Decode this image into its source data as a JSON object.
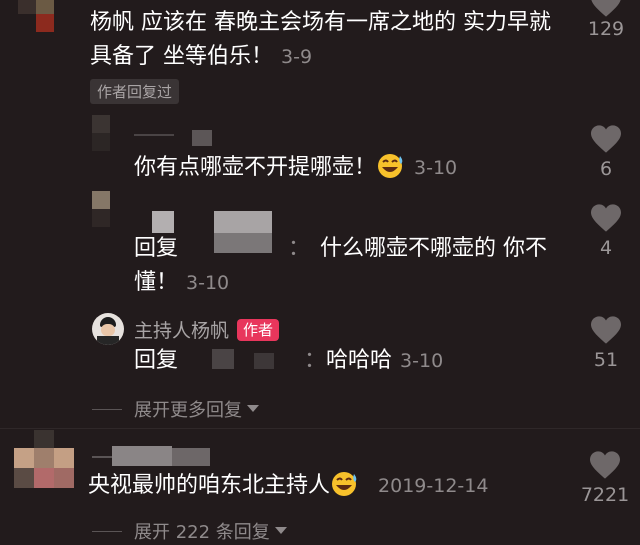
{
  "comments": [
    {
      "text": "杨帆 应该在 春晚主会场有一席之地的 实力早就具备了 坐等伯乐！",
      "date": "3-9",
      "likes": "129",
      "author_replied": "作者回复过",
      "replies": [
        {
          "prefix": "",
          "text": "你有点哪壶不开提哪壶！",
          "emoji": "grin-sweat-emoji",
          "date": "3-10",
          "likes": "6"
        },
        {
          "prefix": "回复",
          "separator": "：",
          "text": "什么哪壶不哪壶的 你不懂！",
          "date": "3-10",
          "likes": "4"
        },
        {
          "username": "主持人杨帆",
          "badge": "作者",
          "prefix": "回复",
          "separator": "：",
          "text": "哈哈哈",
          "date": "3-10",
          "likes": "51"
        }
      ],
      "expand_label": "展开更多回复"
    },
    {
      "text": "央视最帅的咱东北主持人",
      "emoji": "grin-sweat-emoji",
      "date": "2019-12-14",
      "likes": "7221",
      "expand_label": "展开 222 条回复"
    }
  ]
}
